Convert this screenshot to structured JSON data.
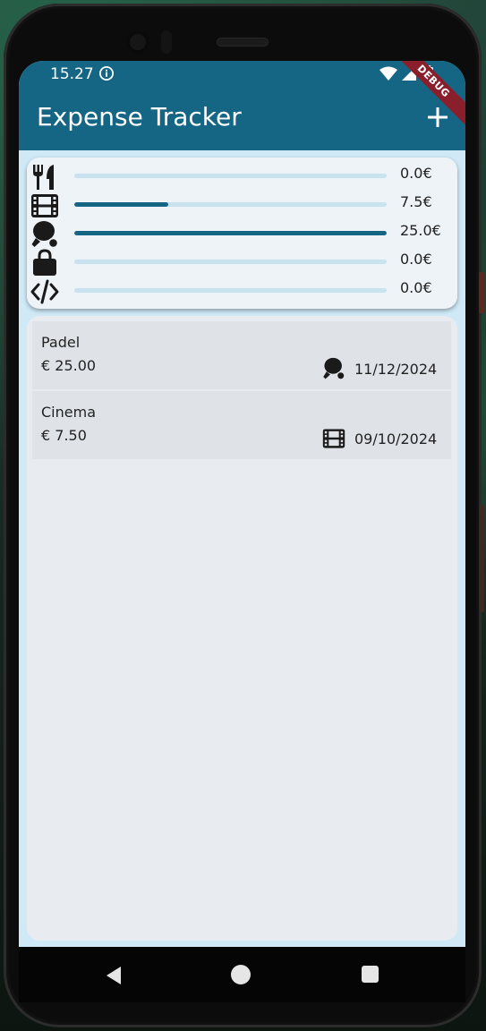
{
  "status_bar": {
    "time": "15.27"
  },
  "app_bar": {
    "title": "Expense Tracker",
    "add_icon": "plus-icon",
    "color": "#156684"
  },
  "debug_banner": {
    "label": "DEBUG",
    "color": "#8a1f2c"
  },
  "summary": {
    "max_value": 25.0,
    "categories": [
      {
        "key": "food",
        "icon": "fork-knife-icon",
        "value": 0.0,
        "label": "0.0€"
      },
      {
        "key": "leisure",
        "icon": "film-icon",
        "value": 7.5,
        "label": "7.5€"
      },
      {
        "key": "sport",
        "icon": "ping-pong-icon",
        "value": 25.0,
        "label": "25.0€"
      },
      {
        "key": "shopping",
        "icon": "lock-bag-icon",
        "value": 0.0,
        "label": "0.0€"
      },
      {
        "key": "work",
        "icon": "code-icon",
        "value": 0.0,
        "label": "0.0€"
      }
    ]
  },
  "expenses": [
    {
      "title": "Padel",
      "amount": "€ 25.00",
      "category_icon": "ping-pong-icon",
      "date": "11/12/2024"
    },
    {
      "title": "Cinema",
      "amount": "€ 7.50",
      "category_icon": "film-icon",
      "date": "09/10/2024"
    }
  ]
}
